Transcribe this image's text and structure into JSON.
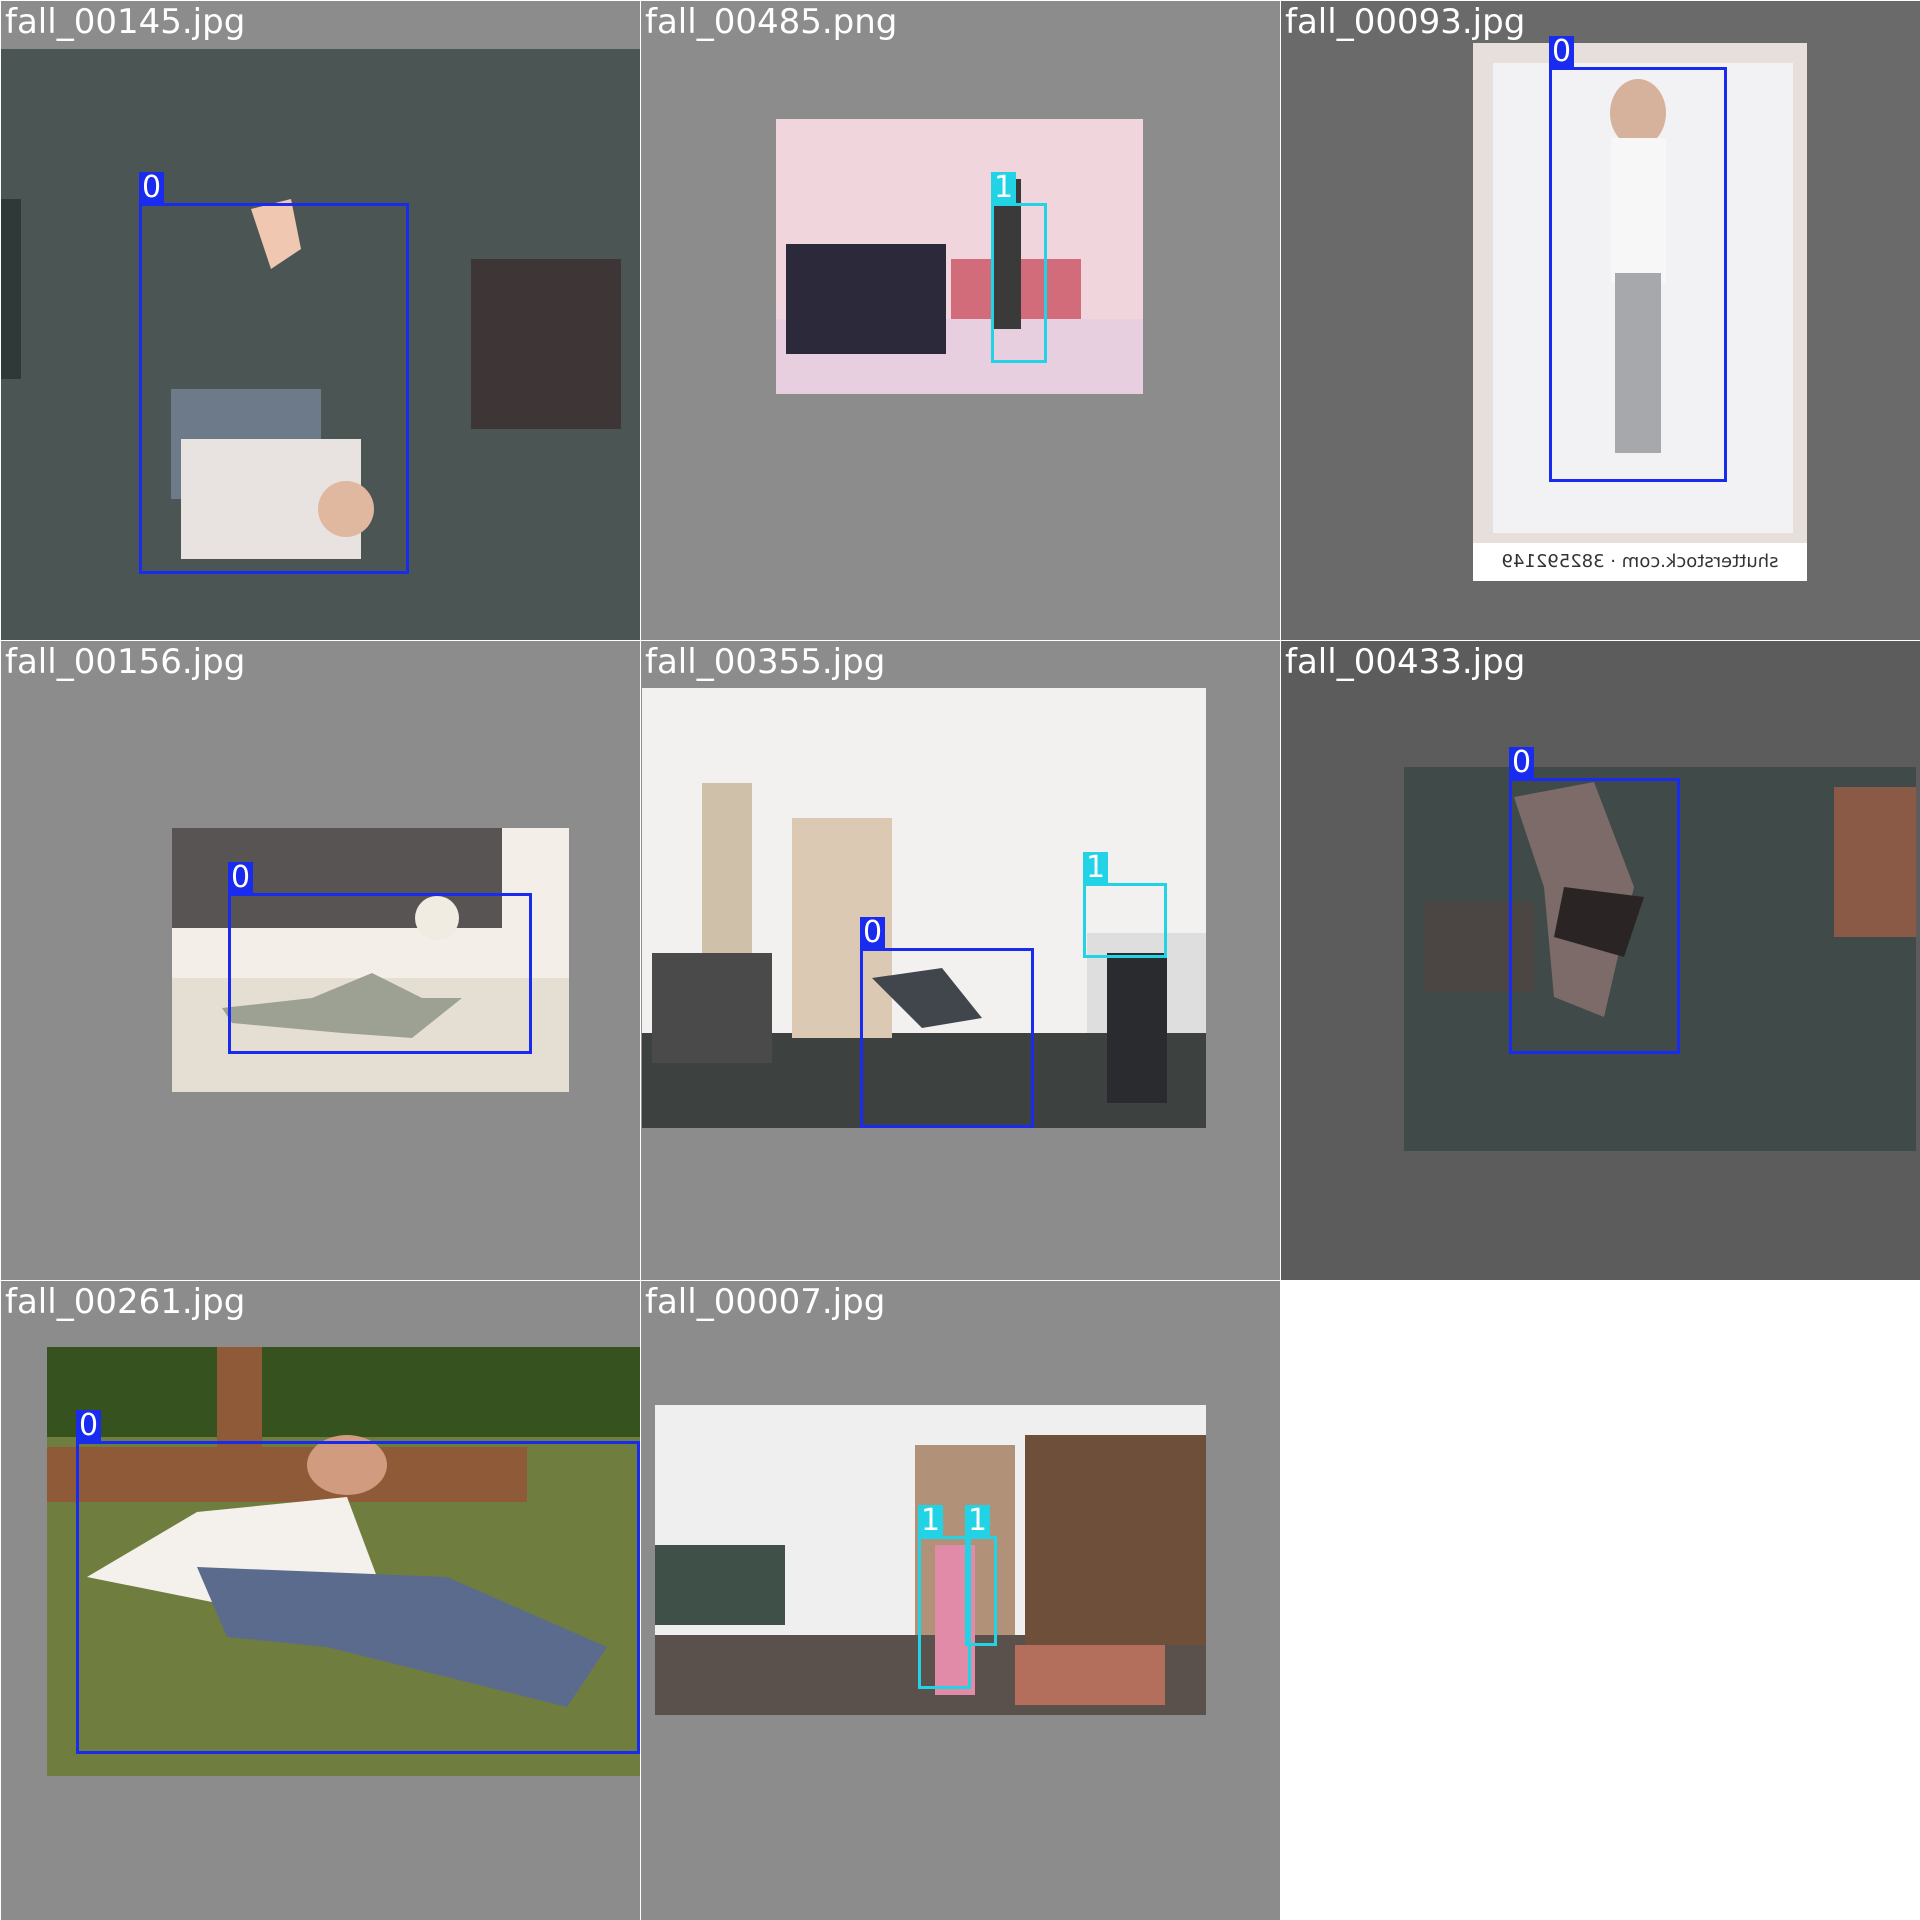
{
  "mosaic": {
    "tiles": [
      {
        "file": "fall_00145.jpg",
        "bg": "#8c8c8c",
        "boxes": [
          {
            "label": "0",
            "color": "#1a2bf0"
          }
        ]
      },
      {
        "file": "fall_00485.png",
        "bg": "#8c8c8c",
        "boxes": [
          {
            "label": "1",
            "color": "#22d3e6"
          }
        ]
      },
      {
        "file": "fall_00093.jpg",
        "bg": "#6a6a6a",
        "watermark": "shutterstock.com · 382592149",
        "boxes": [
          {
            "label": "0",
            "color": "#1a2bf0"
          }
        ]
      },
      {
        "file": "fall_00156.jpg",
        "bg": "#8c8c8c",
        "boxes": [
          {
            "label": "0",
            "color": "#1a2bf0"
          }
        ]
      },
      {
        "file": "fall_00355.jpg",
        "bg": "#8c8c8c",
        "boxes": [
          {
            "label": "1",
            "color": "#22d3e6"
          },
          {
            "label": "0",
            "color": "#1a2bf0"
          }
        ]
      },
      {
        "file": "fall_00433.jpg",
        "bg": "#5c5c5c",
        "boxes": [
          {
            "label": "0",
            "color": "#1a2bf0"
          }
        ]
      },
      {
        "file": "fall_00261.jpg",
        "bg": "#8c8c8c",
        "boxes": [
          {
            "label": "0",
            "color": "#1a2bf0"
          }
        ]
      },
      {
        "file": "fall_00007.jpg",
        "bg": "#8c8c8c",
        "boxes": [
          {
            "label": "1",
            "color": "#22d3e6"
          },
          {
            "label": "1",
            "color": "#22d3e6"
          }
        ]
      }
    ]
  }
}
